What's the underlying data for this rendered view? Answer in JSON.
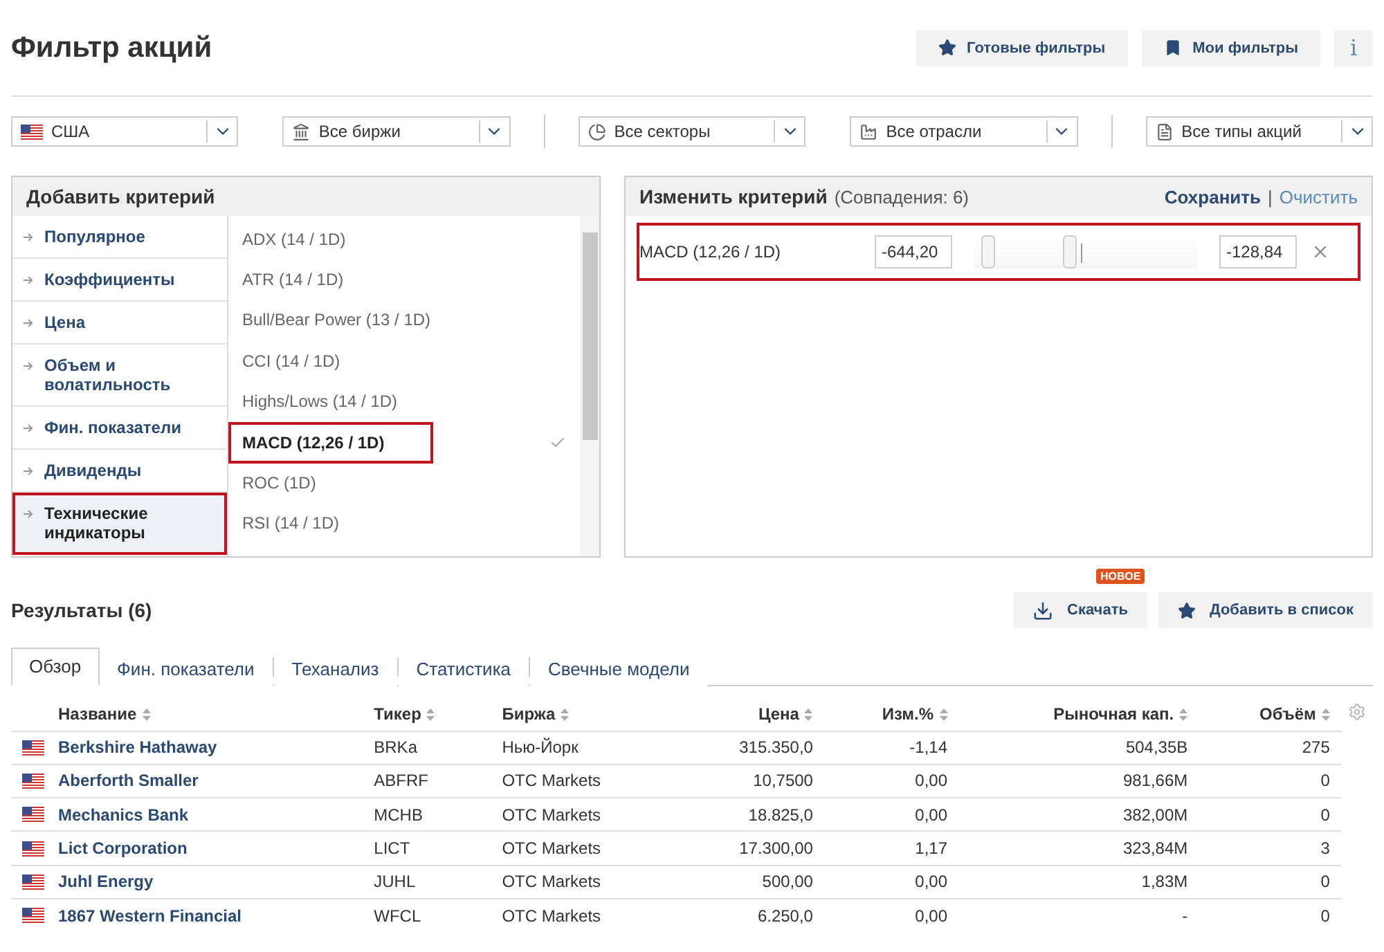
{
  "title": "Фильтр акций",
  "header_buttons": [
    {
      "kind": "star",
      "label": "Готовые фильтры"
    },
    {
      "kind": "bookmark",
      "label": "Мои фильтры"
    },
    {
      "kind": "info",
      "label": "i"
    }
  ],
  "filters": [
    {
      "kind": "flag",
      "value": "США"
    },
    {
      "kind": "bank",
      "value": "Все биржи"
    },
    {
      "kind": "pie",
      "value": "Все секторы"
    },
    {
      "kind": "industry",
      "value": "Все отрасли"
    },
    {
      "kind": "doc",
      "value": "Все типы акций"
    }
  ],
  "add_criteria": {
    "title": "Добавить критерий",
    "categories": [
      {
        "label": "Популярное",
        "selected": false,
        "highlighted": false
      },
      {
        "label": "Коэффициенты",
        "selected": false,
        "highlighted": false
      },
      {
        "label": "Цена",
        "selected": false,
        "highlighted": false
      },
      {
        "label": "Объем и волатильность",
        "selected": false,
        "highlighted": false
      },
      {
        "label": "Фин. показатели",
        "selected": false,
        "highlighted": false
      },
      {
        "label": "Дивиденды",
        "selected": false,
        "highlighted": false
      },
      {
        "label": "Технические индикаторы",
        "selected": true,
        "highlighted": true
      }
    ],
    "indicators": [
      {
        "label": "ADX (14 / 1D)",
        "selected": false,
        "highlighted": false
      },
      {
        "label": "ATR (14 / 1D)",
        "selected": false,
        "highlighted": false
      },
      {
        "label": "Bull/Bear Power (13 / 1D)",
        "selected": false,
        "highlighted": false
      },
      {
        "label": "CCI (14 / 1D)",
        "selected": false,
        "highlighted": false
      },
      {
        "label": "Highs/Lows (14 / 1D)",
        "selected": false,
        "highlighted": false
      },
      {
        "label": "MACD (12,26 / 1D)",
        "selected": true,
        "highlighted": true
      },
      {
        "label": "ROC (1D)",
        "selected": false,
        "highlighted": false
      },
      {
        "label": "RSI (14 / 1D)",
        "selected": false,
        "highlighted": false
      }
    ]
  },
  "edit_criteria": {
    "title": "Изменить критерий",
    "matches": "(Совпадения: 6)",
    "save": "Сохранить",
    "separator": "|",
    "clear": "Очистить",
    "rows": [
      {
        "label": "MACD (12,26 / 1D)",
        "min": "-644,20",
        "max": "-128,84",
        "low": {
          "level": 0.03
        },
        "high": {
          "level": 0.4
        },
        "highlighted": true
      }
    ]
  },
  "results": {
    "title": "Результаты (6)",
    "badge": "НОВОЕ",
    "actions": [
      {
        "kind": "download",
        "label": "Скачать"
      },
      {
        "kind": "star",
        "label": "Добавить в список"
      }
    ],
    "tabs": [
      {
        "label": "Обзор",
        "selected": true
      },
      {
        "label": "Фин. показатели",
        "selected": false
      },
      {
        "label": "Теханализ",
        "selected": false
      },
      {
        "label": "Статистика",
        "selected": false
      },
      {
        "label": "Свечные модели",
        "selected": false
      }
    ],
    "columns": [
      "Название",
      "Тикер",
      "Биржа",
      "Цена",
      "Изм.%",
      "Рыночная кап.",
      "Объём"
    ],
    "rows": [
      [
        "Berkshire Hathaway",
        "BRKa",
        "Нью-Йорк",
        "315.350,0",
        "-1,14",
        "504,35B",
        "275"
      ],
      [
        "Aberforth Smaller",
        "ABFRF",
        "OTC Markets",
        "10,7500",
        "0,00",
        "981,66M",
        "0"
      ],
      [
        "Mechanics Bank",
        "MCHB",
        "OTC Markets",
        "18.825,0",
        "0,00",
        "382,00M",
        "0"
      ],
      [
        "Lict Corporation",
        "LICT",
        "OTC Markets",
        "17.300,00",
        "1,17",
        "323,84M",
        "3"
      ],
      [
        "Juhl Energy",
        "JUHL",
        "OTC Markets",
        "500,00",
        "0,00",
        "1,83M",
        "0"
      ],
      [
        "1867 Western Financial",
        "WFCL",
        "OTC Markets",
        "6.250,0",
        "0,00",
        "-",
        "0"
      ]
    ]
  }
}
